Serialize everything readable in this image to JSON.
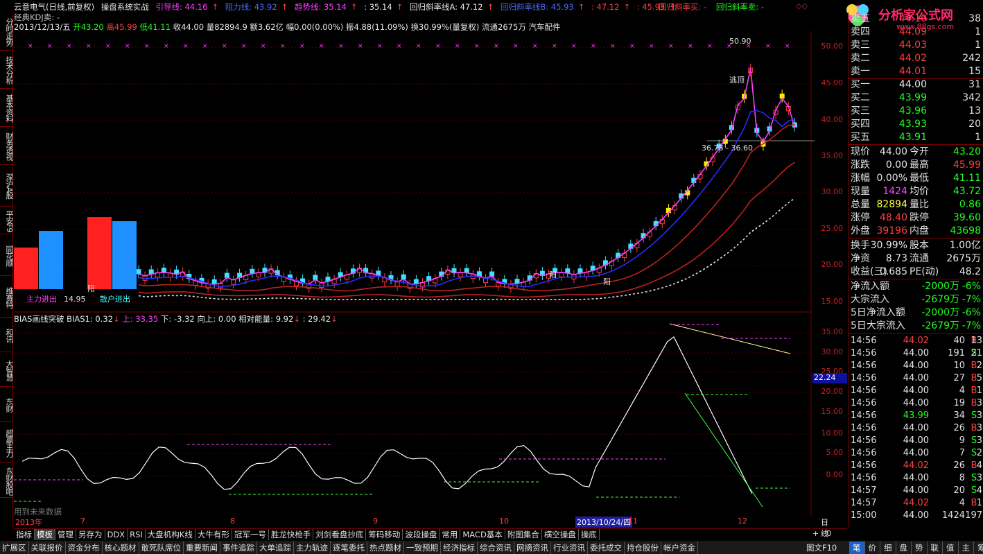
{
  "title_bar": {
    "app_title": "云意电气(日线,前复权)",
    "system_label": "操盘系统实战",
    "guide_line": "引导线: 44.16",
    "resist_line": "阻力线: 43.92",
    "trend_line": "趋势线: 35.14",
    "val_a": ": 35.14",
    "reg_line_a": "回归斜率线A: 47.12",
    "reg_line_b": "回归斜率线B: 45.93",
    "val_b": ": 47.12",
    "val_c": ": 45.93",
    "reg_buy": "回归斜率买: -",
    "reg_sell": "回归斜率卖: -"
  },
  "kdj_label": "经典KDJ卖: -",
  "info_line": {
    "date": "2013/12/13/五",
    "open": "开43.20",
    "high": "高45.99",
    "low": "低41.11",
    "close": "收44.00",
    "volume": "量82894.9",
    "amount": "额3.62亿",
    "range": "幅0.00(0.00%)",
    "amplitude": "振4.88(11.09%)",
    "turnover": "换30.99%(量复权)",
    "circulation": "流通2675万",
    "sector": "汽车配件"
  },
  "main_axis": [
    "50.00",
    "45.00",
    "40.00",
    "35.00",
    "30.00",
    "25.00",
    "20.00",
    "15.00"
  ],
  "sub_axis": [
    "35.00",
    "30.00",
    "25.00",
    "20.00",
    "15.00",
    "10.00",
    "5.00",
    "0.00"
  ],
  "axis_highlight": "22.24",
  "annotations": {
    "peak_price": "50.90",
    "flee": "逃顶",
    "mid_price": "36.78 - 36.60",
    "yang1": "阳",
    "yang2": "阳",
    "yang3": "阳",
    "main_in": "主力进出",
    "retail_in": "散户进出",
    "low_price": "14.95"
  },
  "bias_line": {
    "label": "BIAS画线突破",
    "bias1": "BIAS1: 0.32",
    "up": "上: 33.35",
    "down": "下: -3.32",
    "upward": "向上: 0.00",
    "energy": "相对能量: 9.92",
    "val": ": 29.42"
  },
  "future_label": "用到未来数据",
  "date_axis": [
    "2013年",
    "7",
    "8",
    "9",
    "10",
    "2013/10/24/四",
    "11",
    "12",
    "日线"
  ],
  "sidebar_tabs": [
    "分时走势",
    "技术分析",
    "基本资料",
    "财务透视",
    "深沪A股",
    "平安F9",
    "同花顺",
    "维赛特",
    "和讯",
    "大智慧",
    "东财",
    "超赢主力",
    "东财股吧"
  ],
  "order_book": [
    {
      "k": "卖五",
      "v": "44.10",
      "q": "38",
      "cls": "red"
    },
    {
      "k": "卖四",
      "v": "44.09",
      "q": "1",
      "cls": "red"
    },
    {
      "k": "卖三",
      "v": "44.03",
      "q": "1",
      "cls": "red"
    },
    {
      "k": "卖二",
      "v": "44.02",
      "q": "242",
      "cls": "red"
    },
    {
      "k": "卖一",
      "v": "44.01",
      "q": "15",
      "cls": "red"
    },
    {
      "k": "买一",
      "v": "44.00",
      "q": "31",
      "cls": "white"
    },
    {
      "k": "买二",
      "v": "43.99",
      "q": "342",
      "cls": "green"
    },
    {
      "k": "买三",
      "v": "43.96",
      "q": "13",
      "cls": "green"
    },
    {
      "k": "买四",
      "v": "43.93",
      "q": "20",
      "cls": "green"
    },
    {
      "k": "买五",
      "v": "43.91",
      "q": "1",
      "cls": "green"
    }
  ],
  "quote": [
    {
      "k": "现价",
      "v": "44.00",
      "c1": "white",
      "k2": "今开",
      "v2": "43.20",
      "c2": "green"
    },
    {
      "k": "涨跌",
      "v": "0.00",
      "c1": "white",
      "k2": "最高",
      "v2": "45.99",
      "c2": "red"
    },
    {
      "k": "涨幅",
      "v": "0.00%",
      "c1": "white",
      "k2": "最低",
      "v2": "41.11",
      "c2": "green"
    },
    {
      "k": "现量",
      "v": "1424",
      "c1": "magenta",
      "k2": "均价",
      "v2": "43.72",
      "c2": "green"
    },
    {
      "k": "总量",
      "v": "82894",
      "c1": "yellow",
      "k2": "量比",
      "v2": "0.86",
      "c2": "green"
    },
    {
      "k": "涨停",
      "v": "48.40",
      "c1": "red",
      "k2": "跌停",
      "v2": "39.60",
      "c2": "green"
    },
    {
      "k": "外盘",
      "v": "39196",
      "c1": "red",
      "k2": "内盘",
      "v2": "43698",
      "c2": "green"
    }
  ],
  "stock_info": [
    {
      "k": "换手",
      "v": "30.99%",
      "k2": "股本",
      "v2": "1.00亿"
    },
    {
      "k": "净资",
      "v": "8.73",
      "k2": "流通",
      "v2": "2675万"
    },
    {
      "k": "收益(三)",
      "v": "0.685",
      "k2": "PE(动)",
      "v2": "48.2"
    }
  ],
  "capital_flow": [
    {
      "k": "净流入额",
      "v": "-2000万",
      "p": "-6%"
    },
    {
      "k": "大宗流入",
      "v": "-2679万",
      "p": "-7%"
    },
    {
      "k": "5日净流入额",
      "v": "-2000万",
      "p": "-6%"
    },
    {
      "k": "5日大宗流入",
      "v": "-2679万",
      "p": "-7%"
    }
  ],
  "ticks": [
    {
      "t": "14:56",
      "p": "44.02",
      "pc": "red",
      "q": "40",
      "f": "B",
      "fc": "red",
      "n": "13"
    },
    {
      "t": "14:56",
      "p": "44.00",
      "pc": "white",
      "q": "191",
      "f": "S",
      "fc": "green",
      "n": "21"
    },
    {
      "t": "14:56",
      "p": "44.00",
      "pc": "white",
      "q": "10",
      "f": "B",
      "fc": "red",
      "n": "2"
    },
    {
      "t": "14:56",
      "p": "44.00",
      "pc": "white",
      "q": "27",
      "f": "B",
      "fc": "red",
      "n": "5"
    },
    {
      "t": "14:56",
      "p": "44.00",
      "pc": "white",
      "q": "4",
      "f": "B",
      "fc": "red",
      "n": "1"
    },
    {
      "t": "14:56",
      "p": "44.00",
      "pc": "white",
      "q": "19",
      "f": "B",
      "fc": "red",
      "n": "3"
    },
    {
      "t": "14:56",
      "p": "43.99",
      "pc": "green",
      "q": "34",
      "f": "S",
      "fc": "green",
      "n": "3"
    },
    {
      "t": "14:56",
      "p": "44.00",
      "pc": "white",
      "q": "26",
      "f": "B",
      "fc": "red",
      "n": "3"
    },
    {
      "t": "14:56",
      "p": "44.00",
      "pc": "white",
      "q": "9",
      "f": "S",
      "fc": "green",
      "n": "3"
    },
    {
      "t": "14:56",
      "p": "44.00",
      "pc": "white",
      "q": "7",
      "f": "S",
      "fc": "green",
      "n": "2"
    },
    {
      "t": "14:56",
      "p": "44.02",
      "pc": "red",
      "q": "26",
      "f": "B",
      "fc": "red",
      "n": "4"
    },
    {
      "t": "14:56",
      "p": "44.00",
      "pc": "white",
      "q": "8",
      "f": "S",
      "fc": "green",
      "n": "3"
    },
    {
      "t": "14:57",
      "p": "44.00",
      "pc": "white",
      "q": "20",
      "f": "S",
      "fc": "green",
      "n": "4"
    },
    {
      "t": "14:57",
      "p": "44.02",
      "pc": "red",
      "q": "4",
      "f": "B",
      "fc": "red",
      "n": "1"
    },
    {
      "t": "15:00",
      "p": "44.00",
      "pc": "white",
      "q": "1424",
      "f": "",
      "fc": "white",
      "n": "197"
    }
  ],
  "indicator_tabs": [
    "指标",
    "模板",
    "管理",
    "另存为",
    "DDX",
    "RSI",
    "大盘机构K线",
    "大牛有形",
    "冠军一号",
    "胜龙快枪手",
    "刘剑看盘抄底",
    "筹码移动",
    "波段操盘",
    "常用",
    "MACD基本",
    "附图集合",
    "横空操盘",
    "操底"
  ],
  "bottom_bar": [
    "扩展区",
    "关联报价",
    "资金分布",
    "核心题材",
    "敢死队席位",
    "重要新闻",
    "事件追踪",
    "大单追踪",
    "主力轨迹",
    "逐笔委托",
    "热点题材",
    "一致预期",
    "经济指标",
    "综合资讯",
    "网摘资讯",
    "行业资讯",
    "委托成交",
    "持仓股份",
    "帐户资金"
  ],
  "bottom_right": [
    "笔",
    "价",
    "细",
    "盘",
    "势",
    "联",
    "值",
    "主",
    "筹"
  ],
  "logo_text": "分析家公式网",
  "logo_url": "www.88gs.com",
  "period": "图文F10"
}
